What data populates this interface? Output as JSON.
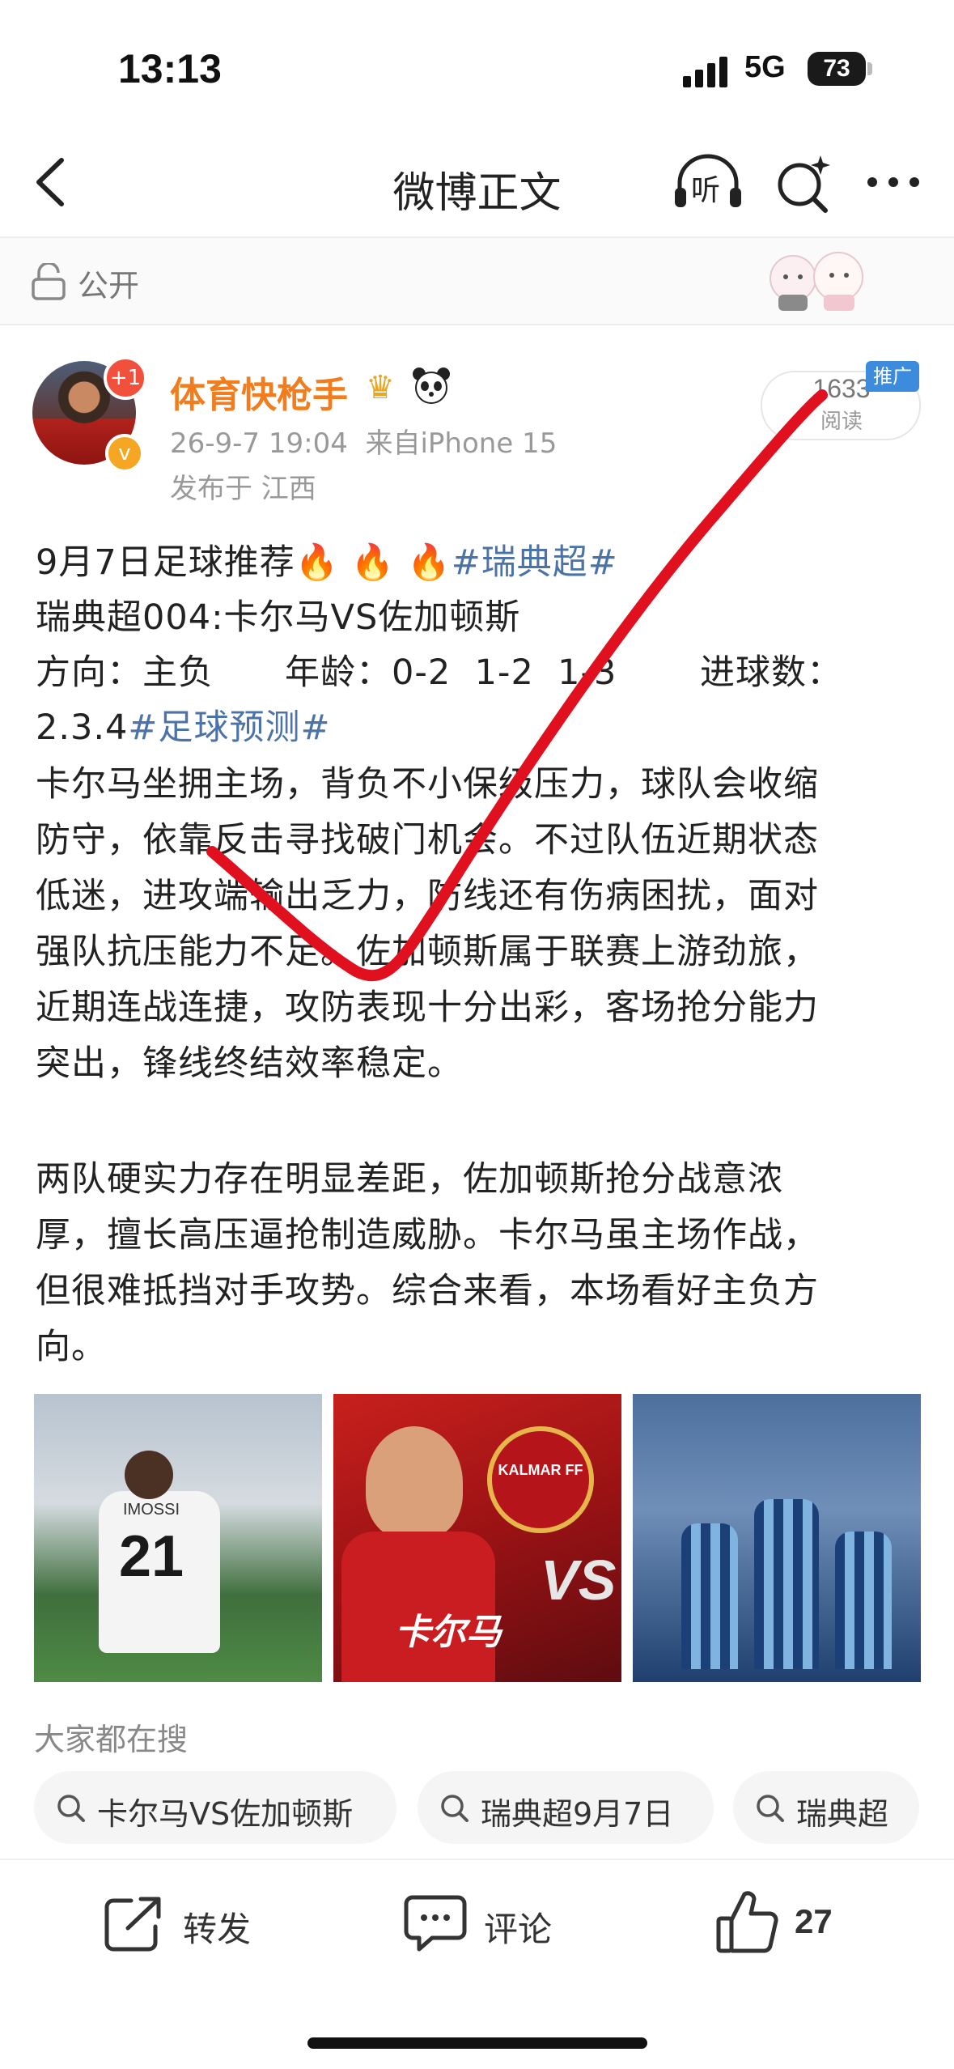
{
  "status_bar": {
    "time": "13:13",
    "network": "5G",
    "battery": "73"
  },
  "nav": {
    "title": "微博正文",
    "back_icon": "back-arrow-icon",
    "listen_icon": "headphones-listen-icon",
    "listen_label": "听",
    "search_icon": "search-sparkle-icon",
    "more_icon": "more-dots-icon"
  },
  "visibility": {
    "label": "公开",
    "icon": "lock-icon"
  },
  "author": {
    "name": "体育快枪手",
    "avatar_badge": "+1",
    "timestamp": "26-9-7 19:04",
    "source": "来自iPhone 15",
    "location": "发布于 江西"
  },
  "read_count": {
    "value": "1633",
    "label": "阅读",
    "promo_badge": "推广"
  },
  "post": {
    "line1_text": "9月7日足球推荐",
    "line1_fire": "🔥 🔥 🔥",
    "line1_tag": "#瑞典超#",
    "line2": "瑞典超004:卡尔马VS佐加顿斯",
    "line3": "方向：主负      年龄：0-2  1-2  1-3       进球数：",
    "line4_text": "2.3.4",
    "line4_tag": "#足球预测#",
    "para1": [
      "卡尔马坐拥主场，背负不小保级压力，球队会收缩",
      "防守，依靠反击寻找破门机会。不过队伍近期状态",
      "低迷，进攻端输出乏力，防线还有伤病困扰，面对",
      "强队抗压能力不足。佐加顿斯属于联赛上游劲旅，",
      "近期连战连捷，攻防表现十分出彩，客场抢分能力",
      "突出，锋线终结效率稳定。"
    ],
    "para2": [
      "两队硬实力存在明显差距，佐加顿斯抢分战意浓",
      "厚，擅长高压逼抢制造威胁。卡尔马虽主场作战，",
      "但很难抵挡对手攻势。综合来看，本场看好主负方",
      "向。"
    ]
  },
  "images": {
    "photo1_number": "21",
    "photo1_name": "IMOSSI",
    "photo2_team": "卡尔马",
    "photo2_vs": "VS",
    "photo2_badge": "KALMAR FF"
  },
  "search_section": {
    "title": "大家都在搜",
    "chips": [
      "卡尔马VS佐加顿斯",
      "瑞典超9月7日",
      "瑞典超"
    ]
  },
  "actions": {
    "repost": "转发",
    "comment": "评论",
    "like_count": "27"
  },
  "colors": {
    "username": "#f27d1e",
    "hashtag": "#4b73a8",
    "promo": "#3d8bdc",
    "annotation_stroke": "#e0101e"
  }
}
